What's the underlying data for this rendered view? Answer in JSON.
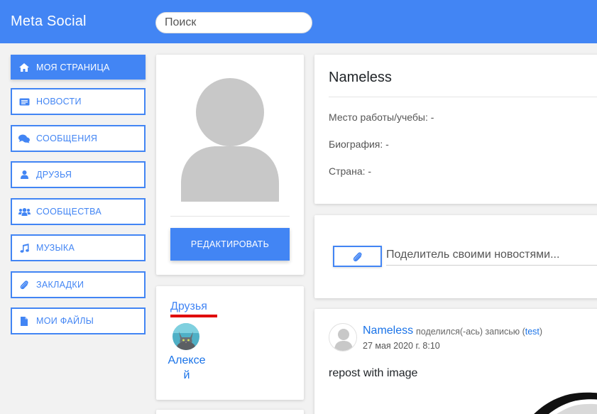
{
  "header": {
    "brand": "Meta Social",
    "search_placeholder": "Поиск",
    "accent": "#4285f4"
  },
  "sidebar": {
    "items": [
      {
        "label": "МОЯ СТРАНИЦА",
        "icon": "home-icon",
        "active": true
      },
      {
        "label": "НОВОСТИ",
        "icon": "newspaper-icon"
      },
      {
        "label": "СООБЩЕНИЯ",
        "icon": "comments-icon"
      },
      {
        "label": "ДРУЗЬЯ",
        "icon": "user-icon"
      },
      {
        "label": "СООБЩЕСТВА",
        "icon": "users-icon"
      },
      {
        "label": "МУЗЫКА",
        "icon": "music-icon"
      },
      {
        "label": "ЗАКЛАДКИ",
        "icon": "paperclip-icon"
      },
      {
        "label": "МОИ ФАЙЛЫ",
        "icon": "file-icon"
      }
    ]
  },
  "profile": {
    "edit_label": "РЕДАКТИРОВАТЬ",
    "name": "Nameless",
    "work": "Место работы/учебы: -",
    "bio": "Биография: -",
    "country": "Страна: -"
  },
  "friends": {
    "title": "Друзья",
    "list": [
      {
        "name": "Алексей"
      }
    ]
  },
  "composer": {
    "placeholder": "Поделитель своими новостями..."
  },
  "post": {
    "author": "Nameless",
    "action": "поделился(-ась) записью (",
    "source": "test",
    "close_paren": ")",
    "date": "27 мая 2020 г. 8:10",
    "text": "repost with image"
  }
}
